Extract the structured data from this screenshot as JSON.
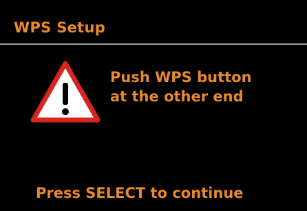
{
  "header": {
    "title": "WPS Setup"
  },
  "dialog": {
    "icon": "warning-icon",
    "message_line1": "Push WPS button",
    "message_line2": "at the other end"
  },
  "footer": {
    "hint": "Press SELECT to continue"
  },
  "colors": {
    "background": "#000000",
    "text": "#e8892a",
    "divider": "#9a9a9a",
    "warning_border": "#d8261f",
    "warning_fill": "#ffffff"
  }
}
